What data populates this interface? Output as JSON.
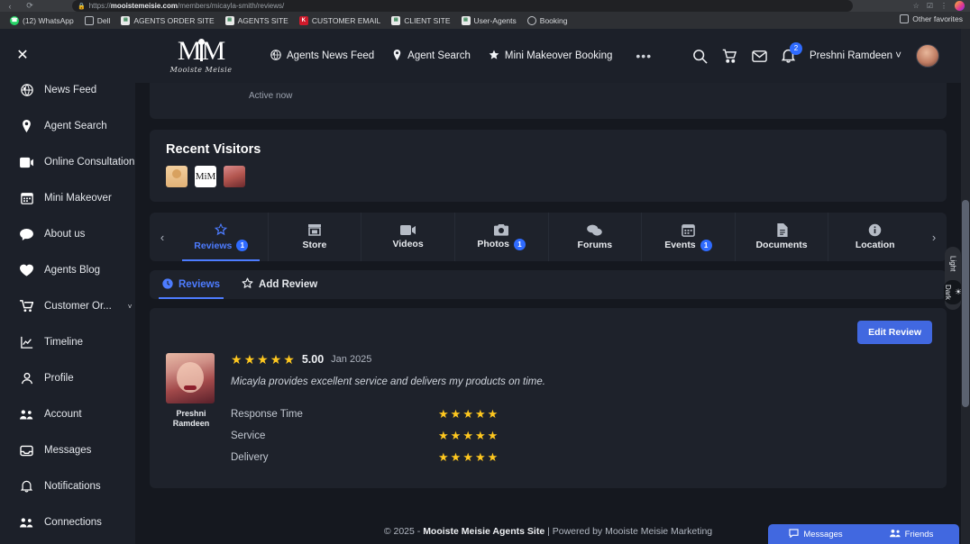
{
  "browser": {
    "url_scheme": "https://",
    "url_domain": "mooistemeisie.com",
    "url_path": "/members/micayla-smith/reviews/",
    "back_icon": "back-arrow-icon",
    "refresh_icon": "reload-icon",
    "lock_icon": "lock-icon",
    "favorite_icon": "star-icon",
    "bookmarks": [
      {
        "label": "(12) WhatsApp",
        "icon": "whatsapp-icon",
        "style": "wa"
      },
      {
        "label": "Dell",
        "icon": "folder-icon",
        "style": "folder"
      },
      {
        "label": "AGENTS ORDER SITE",
        "icon": "sheets-icon",
        "style": "sheet"
      },
      {
        "label": "AGENTS SITE",
        "icon": "sheets-icon",
        "style": "sheet"
      },
      {
        "label": "CUSTOMER EMAIL",
        "icon": "mail-icon",
        "style": "red"
      },
      {
        "label": "CLIENT SITE",
        "icon": "sheets-icon",
        "style": "sheet"
      },
      {
        "label": "User-Agents",
        "icon": "sheets-icon",
        "style": "sheet"
      },
      {
        "label": "Booking",
        "icon": "globe-icon",
        "style": "globe"
      }
    ],
    "other_favorites": "Other favorites"
  },
  "topnav": {
    "close_label": "✕",
    "brand_mark_left": "M",
    "brand_mark_right": "M",
    "brand_subtitle": "Mooiste Meisie",
    "links": [
      {
        "label": "Agents News Feed",
        "icon": "globe-icon"
      },
      {
        "label": "Agent Search",
        "icon": "location-pin-icon"
      },
      {
        "label": "Mini Makeover Booking",
        "icon": "star-icon"
      }
    ],
    "more_label": "•••",
    "icons": {
      "search": "search-icon",
      "cart": "cart-icon",
      "messages": "envelope-icon",
      "notifications": "bell-icon"
    },
    "notification_count": "2",
    "user_name": "Preshni Ramdeen",
    "user_chevron": "˅"
  },
  "sidebar": {
    "items": [
      {
        "label": "News Feed",
        "icon": "globe-icon",
        "caret": ""
      },
      {
        "label": "Agent Search",
        "icon": "location-pin-icon",
        "caret": ""
      },
      {
        "label": "Online Consultation",
        "icon": "video-chat-icon",
        "caret": ""
      },
      {
        "label": "Mini Makeover",
        "icon": "calendar-icon",
        "caret": ""
      },
      {
        "label": "About us",
        "icon": "chat-bubble-icon",
        "caret": ""
      },
      {
        "label": "Agents Blog",
        "icon": "heart-icon",
        "caret": ""
      },
      {
        "label": "Customer Or...",
        "icon": "cart-icon",
        "caret": "˅"
      },
      {
        "label": "Timeline",
        "icon": "chart-line-icon",
        "caret": ""
      },
      {
        "label": "Profile",
        "icon": "user-icon",
        "caret": ""
      },
      {
        "label": "Account",
        "icon": "users-gear-icon",
        "caret": ""
      },
      {
        "label": "Messages",
        "icon": "inbox-icon",
        "caret": ""
      },
      {
        "label": "Notifications",
        "icon": "bell-icon",
        "caret": ""
      },
      {
        "label": "Connections",
        "icon": "users-icon",
        "caret": ""
      }
    ]
  },
  "main": {
    "status_card": {
      "active_label": "Active now"
    },
    "recent_visitors": {
      "title": "Recent Visitors",
      "visitors": [
        {
          "name": "visitor-1",
          "kind": "placeholder"
        },
        {
          "name": "visitor-2",
          "kind": "logo",
          "text": "MiM"
        },
        {
          "name": "visitor-3",
          "kind": "photo"
        }
      ]
    },
    "tabs": {
      "prev_arrow": "‹",
      "next_arrow": "›",
      "items": [
        {
          "label": "Reviews",
          "icon": "star-badge-icon",
          "badge": "1",
          "active": true
        },
        {
          "label": "Store",
          "icon": "store-icon",
          "badge": "",
          "active": false
        },
        {
          "label": "Videos",
          "icon": "video-icon",
          "badge": "",
          "active": false
        },
        {
          "label": "Photos",
          "icon": "camera-icon",
          "badge": "1",
          "active": false
        },
        {
          "label": "Forums",
          "icon": "forum-icon",
          "badge": "",
          "active": false
        },
        {
          "label": "Events",
          "icon": "calendar-icon",
          "badge": "1",
          "active": false
        },
        {
          "label": "Documents",
          "icon": "document-icon",
          "badge": "",
          "active": false
        },
        {
          "label": "Location",
          "icon": "info-circle-icon",
          "badge": "",
          "active": false
        }
      ]
    },
    "subnav": [
      {
        "label": "Reviews",
        "icon": "clock-circle-icon",
        "active": true
      },
      {
        "label": "Add Review",
        "icon": "star-outline-icon",
        "active": false
      }
    ],
    "review": {
      "edit_label": "Edit Review",
      "reviewer_name": "Preshni\nRamdeen",
      "reviewer_name_line1": "Preshni",
      "reviewer_name_line2": "Ramdeen",
      "stars": 5,
      "score": "5.00",
      "date": "Jan 2025",
      "text": "Micayla provides excellent service and delivers my products on time.",
      "criteria": [
        {
          "label": "Response Time",
          "stars": 5
        },
        {
          "label": "Service",
          "stars": 5
        },
        {
          "label": "Delivery",
          "stars": 5
        }
      ]
    },
    "footer": {
      "copyright": "© 2025 - ",
      "site_name": "Mooiste Meisie Agents Site",
      "powered": " | Powered by Mooiste Meisie Marketing"
    }
  },
  "theme_switch": {
    "light_label": "Light",
    "dark_label": "Dark",
    "dark_icon": "sun-icon",
    "active": "Dark"
  },
  "chat_dock": {
    "messages_label": "Messages",
    "messages_icon": "chat-icon",
    "friends_label": "Friends",
    "friends_icon": "friends-icon"
  },
  "colors": {
    "accent": "#4d7cff",
    "button": "#4168e0",
    "star": "#ffc81f",
    "page_bg": "#15181f",
    "card_bg": "#1e222b",
    "panel_bg": "#1c2029"
  }
}
